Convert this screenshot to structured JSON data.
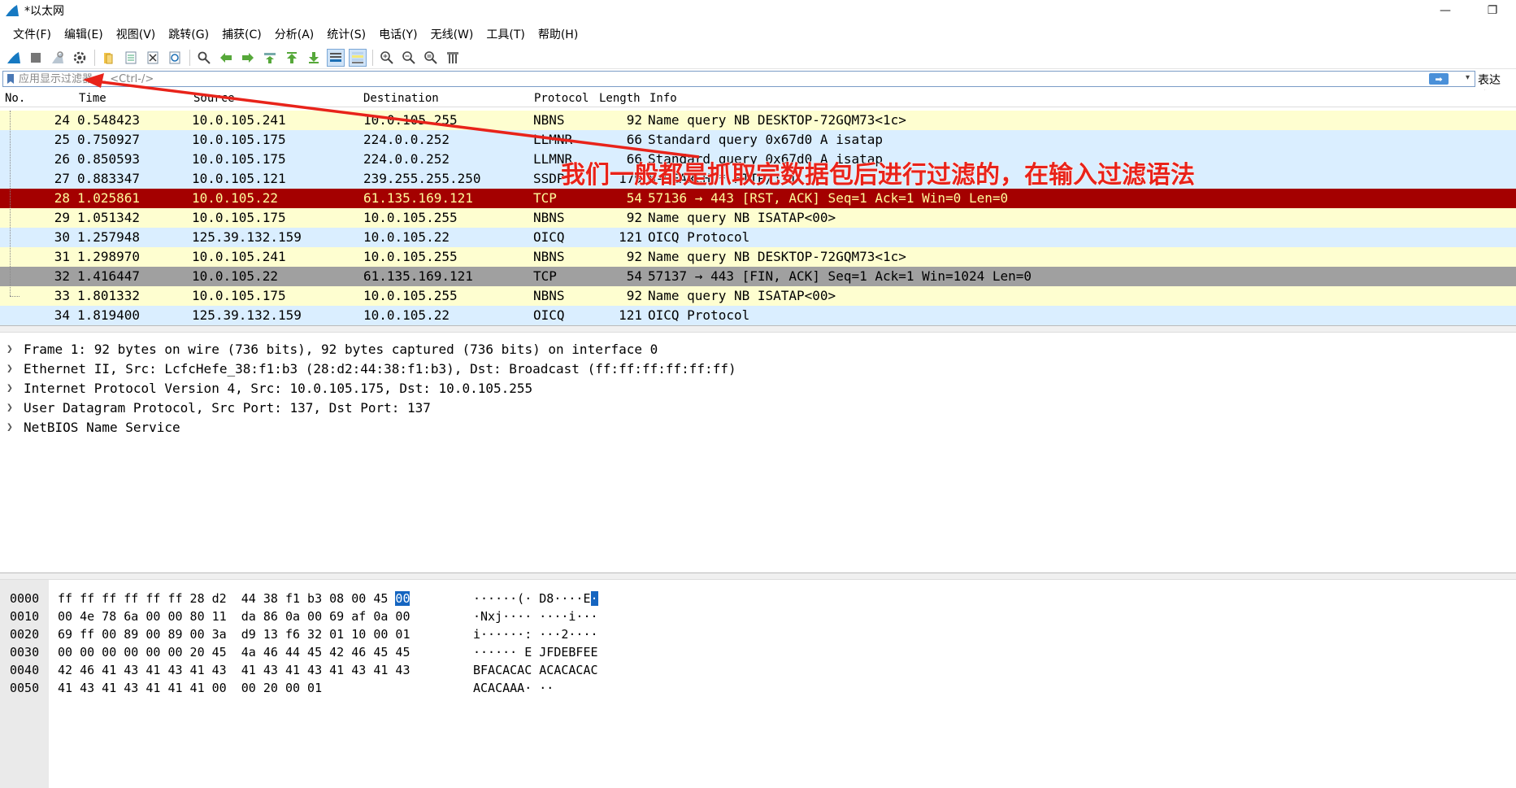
{
  "window": {
    "title": "*以太网",
    "minimize_glyph": "—",
    "maximize_glyph": "❐"
  },
  "menu": [
    "文件(F)",
    "编辑(E)",
    "视图(V)",
    "跳转(G)",
    "捕获(C)",
    "分析(A)",
    "统计(S)",
    "电话(Y)",
    "无线(W)",
    "工具(T)",
    "帮助(H)"
  ],
  "toolbar_icons": [
    "shark-start-icon",
    "stop-icon",
    "restart-icon",
    "options-gear-icon",
    "open-file-icon",
    "save-file-icon",
    "close-file-icon",
    "reload-icon",
    "find-icon",
    "back-arrow-icon",
    "forward-arrow-icon",
    "goto-packet-icon",
    "first-packet-icon",
    "last-packet-icon",
    "autoscroll-icon",
    "colorize-icon",
    "zoom-in-icon",
    "zoom-out-icon",
    "zoom-reset-icon",
    "resize-columns-icon"
  ],
  "filter": {
    "placeholder": "应用显示过滤器 … <Ctrl-/>",
    "expression_label": "表达式…"
  },
  "columns": {
    "no": "No.",
    "time": "Time",
    "source": "Source",
    "destination": "Destination",
    "protocol": "Protocol",
    "length": "Length",
    "info": "Info"
  },
  "packets": [
    {
      "no": "24",
      "time": "0.548423",
      "src": "10.0.105.241",
      "dst": "10.0.105.255",
      "proto": "NBNS",
      "len": "92",
      "info": "Name query NB DESKTOP-72GQM73<1c>",
      "bg": "#fefed0",
      "fg": "#000000"
    },
    {
      "no": "25",
      "time": "0.750927",
      "src": "10.0.105.175",
      "dst": "224.0.0.252",
      "proto": "LLMNR",
      "len": "66",
      "info": "Standard query 0x67d0 A isatap",
      "bg": "#daeeff",
      "fg": "#000000"
    },
    {
      "no": "26",
      "time": "0.850593",
      "src": "10.0.105.175",
      "dst": "224.0.0.252",
      "proto": "LLMNR",
      "len": "66",
      "info": "Standard query 0x67d0 A isatap",
      "bg": "#daeeff",
      "fg": "#000000"
    },
    {
      "no": "27",
      "time": "0.883347",
      "src": "10.0.105.121",
      "dst": "239.255.255.250",
      "proto": "SSDP",
      "len": "179",
      "info": "M-SEARCH * HTTP/1.1",
      "bg": "#daeeff",
      "fg": "#000000"
    },
    {
      "no": "28",
      "time": "1.025861",
      "src": "10.0.105.22",
      "dst": "61.135.169.121",
      "proto": "TCP",
      "len": "54",
      "info": "57136 → 443 [RST, ACK] Seq=1 Ack=1 Win=0 Len=0",
      "bg": "#a40000",
      "fg": "#fffc9c"
    },
    {
      "no": "29",
      "time": "1.051342",
      "src": "10.0.105.175",
      "dst": "10.0.105.255",
      "proto": "NBNS",
      "len": "92",
      "info": "Name query NB ISATAP<00>",
      "bg": "#fefed0",
      "fg": "#000000"
    },
    {
      "no": "30",
      "time": "1.257948",
      "src": "125.39.132.159",
      "dst": "10.0.105.22",
      "proto": "OICQ",
      "len": "121",
      "info": "OICQ Protocol",
      "bg": "#daeeff",
      "fg": "#000000"
    },
    {
      "no": "31",
      "time": "1.298970",
      "src": "10.0.105.241",
      "dst": "10.0.105.255",
      "proto": "NBNS",
      "len": "92",
      "info": "Name query NB DESKTOP-72GQM73<1c>",
      "bg": "#fefed0",
      "fg": "#000000"
    },
    {
      "no": "32",
      "time": "1.416447",
      "src": "10.0.105.22",
      "dst": "61.135.169.121",
      "proto": "TCP",
      "len": "54",
      "info": "57137 → 443 [FIN, ACK] Seq=1 Ack=1 Win=1024 Len=0",
      "bg": "#a0a0a0",
      "fg": "#000000"
    },
    {
      "no": "33",
      "time": "1.801332",
      "src": "10.0.105.175",
      "dst": "10.0.105.255",
      "proto": "NBNS",
      "len": "92",
      "info": "Name query NB ISATAP<00>",
      "bg": "#fefed0",
      "fg": "#000000"
    },
    {
      "no": "34",
      "time": "1.819400",
      "src": "125.39.132.159",
      "dst": "10.0.105.22",
      "proto": "OICQ",
      "len": "121",
      "info": "OICQ Protocol",
      "bg": "#daeeff",
      "fg": "#000000"
    }
  ],
  "details": [
    "Frame 1: 92 bytes on wire (736 bits), 92 bytes captured (736 bits) on interface 0",
    "Ethernet II, Src: LcfcHefe_38:f1:b3 (28:d2:44:38:f1:b3), Dst: Broadcast (ff:ff:ff:ff:ff:ff)",
    "Internet Protocol Version 4, Src: 10.0.105.175, Dst: 10.0.105.255",
    "User Datagram Protocol, Src Port: 137, Dst Port: 137",
    "NetBIOS Name Service"
  ],
  "bytes": [
    {
      "off": "0000",
      "hex": "ff ff ff ff ff ff 28 d2  44 38 f1 b3 08 00 45 ",
      "hex_hl": "00",
      "ascii": "······(· D8····E",
      "ascii_hl": "·"
    },
    {
      "off": "0010",
      "hex": "00 4e 78 6a 00 00 80 11  da 86 0a 00 69 af 0a 00",
      "hex_hl": "",
      "ascii": "·Nxj···· ····i···",
      "ascii_hl": ""
    },
    {
      "off": "0020",
      "hex": "69 ff 00 89 00 89 00 3a  d9 13 f6 32 01 10 00 01",
      "hex_hl": "",
      "ascii": "i······: ···2····",
      "ascii_hl": ""
    },
    {
      "off": "0030",
      "hex": "00 00 00 00 00 00 20 45  4a 46 44 45 42 46 45 45",
      "hex_hl": "",
      "ascii": "······ E JFDEBFEE",
      "ascii_hl": ""
    },
    {
      "off": "0040",
      "hex": "42 46 41 43 41 43 41 43  41 43 41 43 41 43 41 43",
      "hex_hl": "",
      "ascii": "BFACACAC ACACACAC",
      "ascii_hl": ""
    },
    {
      "off": "0050",
      "hex": "41 43 41 43 41 41 41 00  00 20 00 01",
      "hex_hl": "",
      "ascii": "ACACAAA· ··",
      "ascii_hl": ""
    }
  ],
  "annotation": {
    "text": "我们一般都是抓取完数据包后进行过滤的，在输入过滤语法",
    "color": "#e8231a"
  }
}
